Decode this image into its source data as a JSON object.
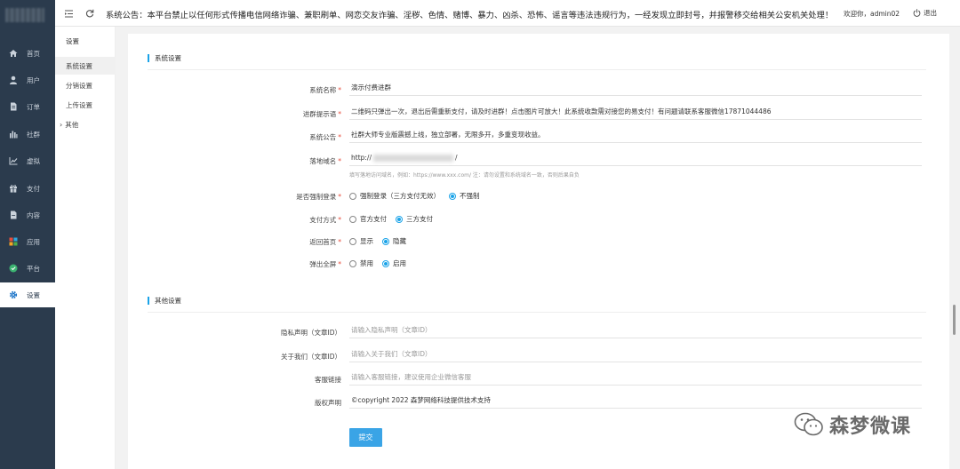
{
  "sidebar": {
    "items": [
      {
        "label": "首页",
        "icon": "home-icon"
      },
      {
        "label": "用户",
        "icon": "user-icon"
      },
      {
        "label": "订单",
        "icon": "order-icon"
      },
      {
        "label": "社群",
        "icon": "community-icon"
      },
      {
        "label": "虚拟",
        "icon": "chart-icon"
      },
      {
        "label": "支付",
        "icon": "gift-icon"
      },
      {
        "label": "内容",
        "icon": "document-icon"
      },
      {
        "label": "应用",
        "icon": "apps-icon"
      },
      {
        "label": "平台",
        "icon": "platform-icon"
      },
      {
        "label": "设置",
        "icon": "gear-icon",
        "active": true
      }
    ]
  },
  "submenu": {
    "title": "设置",
    "items": [
      {
        "label": "系统设置",
        "active": true
      },
      {
        "label": "分销设置"
      },
      {
        "label": "上传设置"
      },
      {
        "label": "其他",
        "chevron": "›"
      }
    ]
  },
  "topbar": {
    "notice": "系统公告：本平台禁止以任何形式传播电信网络诈骗、兼职刷单、网恋交友诈骗、淫秽、色情、赌博、暴力、凶杀、恐怖、谣言等违法违规行为，一经发现立即封号，并报警移交给相关公安机关处理！",
    "welcome": "欢迎你，admin02",
    "logout": "退出"
  },
  "form": {
    "section1_title": "系统设置",
    "section2_title": "其他设置",
    "fields": {
      "system_name": {
        "label": "系统名称",
        "value": "演示付费进群"
      },
      "join_tip": {
        "label": "进群提示语",
        "value": "二维码只弹出一次，退出后需重新支付，请及时进群！点击图片可放大！此系统收款需对接您的易支付！有问题请联系客服微信17871044486"
      },
      "announcement": {
        "label": "系统公告",
        "value": "社群大师专业版震撼上线，独立部署，无限多开，多重变现收益。"
      },
      "domain": {
        "label": "落地域名",
        "prefix": "http://",
        "suffix": "/",
        "hint": "填写落地访问域名，例如：https://www.xxx.com/ 注：请勿设置和系统域名一致，否则后果自负"
      },
      "force_login": {
        "label": "是否强制登录",
        "options": [
          "强制登录（三方支付无效）",
          "不强制"
        ],
        "selected": 1
      },
      "pay_method": {
        "label": "支付方式",
        "options": [
          "官方支付",
          "三方支付"
        ],
        "selected": 1
      },
      "back_home": {
        "label": "返回首页",
        "options": [
          "显示",
          "隐藏"
        ],
        "selected": 1
      },
      "popup_full": {
        "label": "弹出全屏",
        "options": [
          "禁用",
          "启用"
        ],
        "selected": 1
      },
      "privacy": {
        "label": "隐私声明（文章ID）",
        "placeholder": "请输入隐私声明（文章ID）"
      },
      "about": {
        "label": "关于我们（文章ID）",
        "placeholder": "请输入关于我们（文章ID）"
      },
      "service_link": {
        "label": "客服链接",
        "placeholder": "请输入客服链接，建议使用企业微信客服"
      },
      "copyright": {
        "label": "版权声明",
        "value": "©copyright 2022 森梦网络科技提供技术支持"
      }
    },
    "submit_label": "提交"
  },
  "watermark": {
    "text": "森梦微课"
  },
  "colors": {
    "sidebar": "#2b3b4d",
    "accent": "#1aa3e8",
    "required": "#e74c3c"
  }
}
